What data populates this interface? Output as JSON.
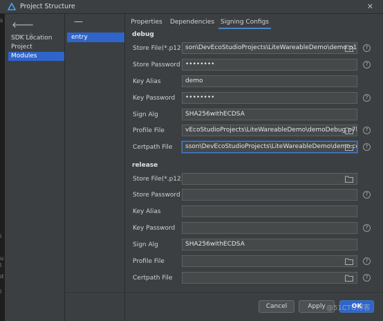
{
  "window": {
    "title": "Project Structure",
    "close_glyph": "✕"
  },
  "nav": {
    "back_glyph": "🡐",
    "forward_glyph": "🡒",
    "items": [
      {
        "label": "SDK Location"
      },
      {
        "label": "Project"
      },
      {
        "label": "Modules"
      }
    ]
  },
  "modules": {
    "remove_glyph": "—",
    "items": [
      {
        "label": "entry"
      }
    ]
  },
  "tabs": [
    {
      "label": "Properties"
    },
    {
      "label": "Dependencies"
    },
    {
      "label": "Signing Configs"
    }
  ],
  "debug": {
    "title": "debug",
    "store_file": {
      "label": "Store File(*.p12)",
      "value": "son\\DevEcoStudioProjects\\LiteWareableDemo\\demo.p12"
    },
    "store_password": {
      "label": "Store Password",
      "value": "••••••••"
    },
    "key_alias": {
      "label": "Key Alias",
      "value": "demo"
    },
    "key_password": {
      "label": "Key Password",
      "value": "••••••••"
    },
    "sign_alg": {
      "label": "Sign Alg",
      "value": "SHA256withECDSA"
    },
    "profile_file": {
      "label": "Profile File",
      "value": "vEcoStudioProjects\\LiteWareableDemo\\demoDebug.p7b"
    },
    "certpath_file": {
      "label": "Certpath File",
      "value": "sson\\DevEcoStudioProjects\\LiteWareableDemo\\demo.cer"
    }
  },
  "release": {
    "title": "release",
    "store_file": {
      "label": "Store File(*.p12)",
      "value": ""
    },
    "store_password": {
      "label": "Store Password",
      "value": ""
    },
    "key_alias": {
      "label": "Key Alias",
      "value": ""
    },
    "key_password": {
      "label": "Key Password",
      "value": ""
    },
    "sign_alg": {
      "label": "Sign Alg",
      "value": "SHA256withECDSA"
    },
    "profile_file": {
      "label": "Profile File",
      "value": ""
    },
    "certpath_file": {
      "label": "Certpath File",
      "value": ""
    }
  },
  "buttons": {
    "cancel": "Cancel",
    "apply": "Apply",
    "ok": "OK"
  },
  "help_glyph": "?",
  "watermark": "@51CTO博客",
  "left_strip_marks": [
    "s",
    "i",
    "u",
    "l",
    "d",
    "i"
  ],
  "colors": {
    "background": "#3c3f41",
    "selection": "#2f65ca",
    "tab_underline": "#4a88c7",
    "focus_border": "#3d7ecf"
  }
}
